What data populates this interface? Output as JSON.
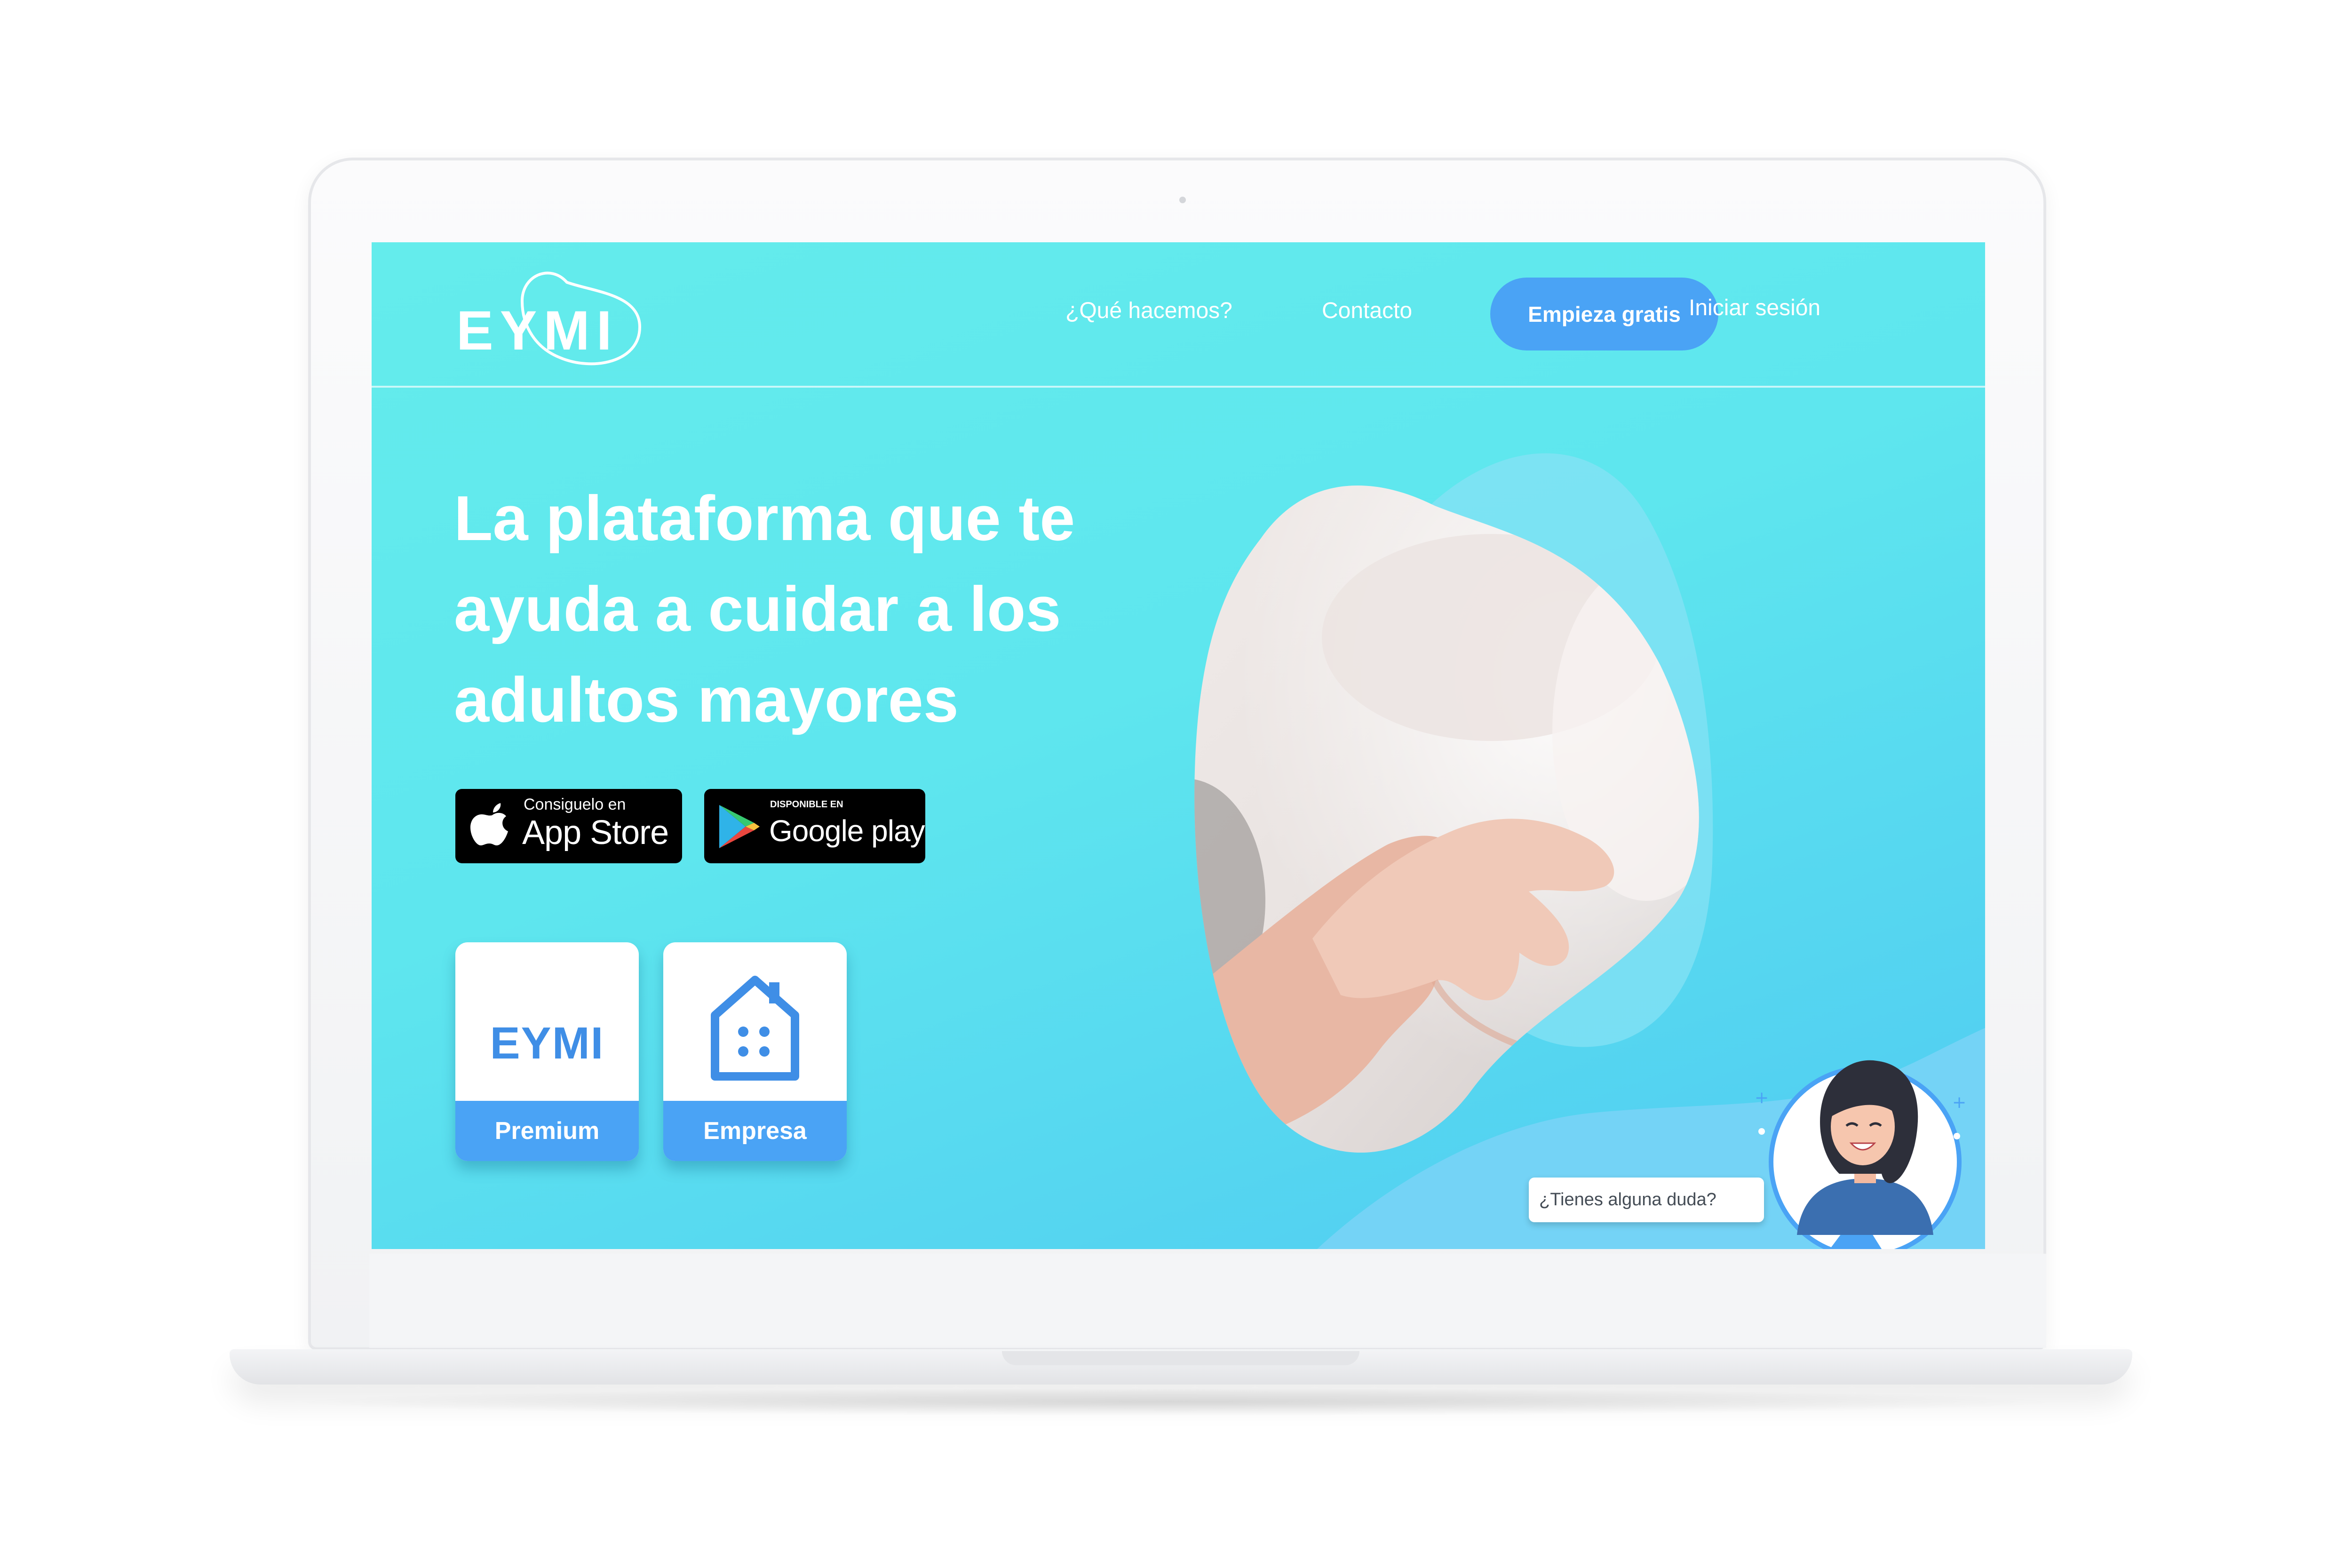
{
  "brand": {
    "name": "EYMI"
  },
  "nav": {
    "about": "¿Qué hacemos?",
    "contact": "Contacto",
    "cta": "Empieza gratis",
    "login": "Iniciar sesión"
  },
  "hero": {
    "title_lines": [
      "La plataforma que te",
      "ayuda a cuidar a los",
      "adultos mayores"
    ]
  },
  "badges": {
    "apple": {
      "small": "Consiguelo en",
      "big": "App Store",
      "icon": "apple-icon"
    },
    "google": {
      "small": "DISPONIBLE EN",
      "big": "Google play",
      "icon": "google-play-icon"
    }
  },
  "cards": {
    "premium": {
      "logo": "EYMI",
      "label": "Premium"
    },
    "empresa": {
      "label": "Empresa",
      "icon": "building-icon"
    }
  },
  "chat": {
    "prompt": "¿Tienes alguna duda?"
  },
  "colors": {
    "gradient_start": "#64ecec",
    "gradient_end": "#4fcaf2",
    "accent_blue": "#4aa3f5",
    "text_white": "#ffffff"
  }
}
